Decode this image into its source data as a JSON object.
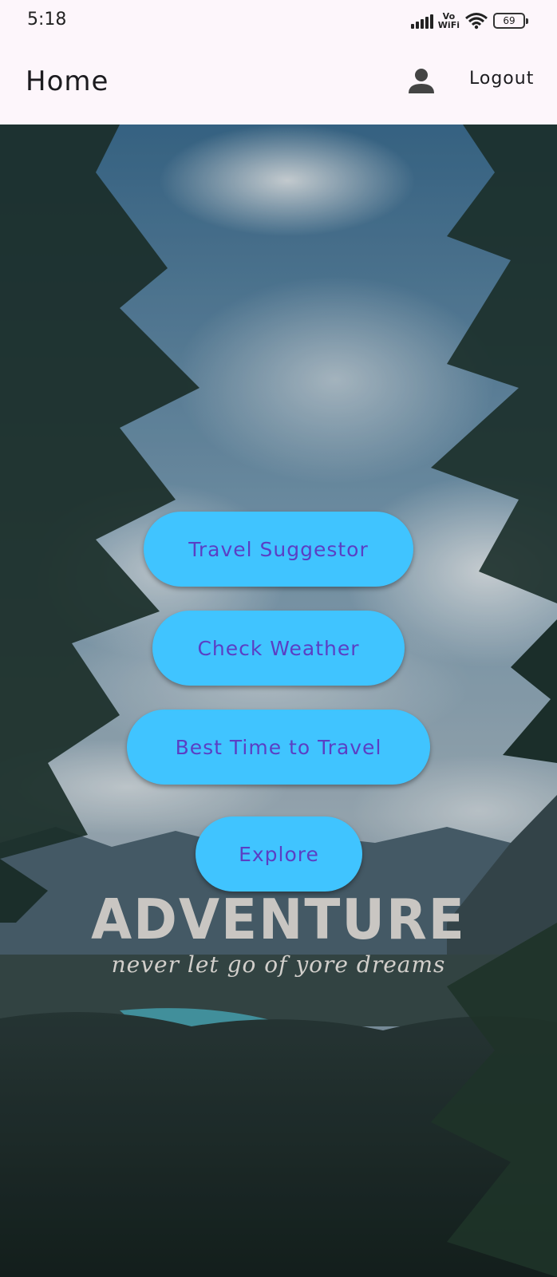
{
  "status_bar": {
    "time": "5:18",
    "network_label_top": "Vo",
    "network_label_bottom": "WiFi",
    "battery": "69",
    "icons": [
      "signal-bars-icon",
      "vowifi-icon",
      "wifi-icon",
      "battery-icon"
    ]
  },
  "app_bar": {
    "title": "Home",
    "profile_icon": "person-icon",
    "logout_label": "Logout"
  },
  "background": {
    "poster_title": "ADVENTURE",
    "poster_subtitle": "never let go of yore dreams"
  },
  "menu": {
    "travel_suggestor": "Travel Suggestor",
    "check_weather": "Check Weather",
    "best_time": "Best Time to Travel",
    "explore": "Explore"
  },
  "colors": {
    "app_bar_bg": "#fdf6fb",
    "button_bg": "#40c4ff",
    "button_text": "#5b3fc4"
  }
}
